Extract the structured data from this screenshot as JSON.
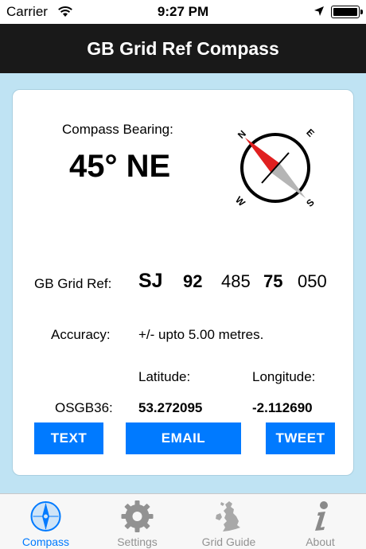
{
  "status_bar": {
    "carrier": "Carrier",
    "time": "9:27 PM"
  },
  "nav": {
    "title": "GB Grid Ref Compass"
  },
  "compass": {
    "label": "Compass Bearing:",
    "bearing": "45° NE",
    "dial": {
      "n": "N",
      "e": "E",
      "s": "S",
      "w": "W"
    }
  },
  "grid_ref": {
    "label": "GB Grid Ref:",
    "letters": "SJ",
    "easting_major": "92",
    "easting_minor": "485",
    "northing_major": "75",
    "northing_minor": "050"
  },
  "accuracy": {
    "label": "Accuracy:",
    "value": "+/- upto 5.00 metres."
  },
  "coordinates": {
    "lat_header": "Latitude:",
    "lon_header": "Longitude:",
    "datum_label": "OSGB36:",
    "latitude": "53.272095",
    "longitude": "-2.112690"
  },
  "buttons": {
    "text": "TEXT",
    "email": "EMAIL",
    "tweet": "TWEET"
  },
  "tabs": [
    {
      "label": "Compass",
      "icon": "compass-icon",
      "active": true
    },
    {
      "label": "Settings",
      "icon": "gear-icon",
      "active": false
    },
    {
      "label": "Grid Guide",
      "icon": "map-icon",
      "active": false
    },
    {
      "label": "About",
      "icon": "info-icon",
      "active": false
    }
  ],
  "colors": {
    "accent": "#007aff",
    "nav_bg": "#191919",
    "page_bg": "#bfe3f3",
    "needle_north": "#e02020",
    "needle_south": "#b5b5b5"
  }
}
